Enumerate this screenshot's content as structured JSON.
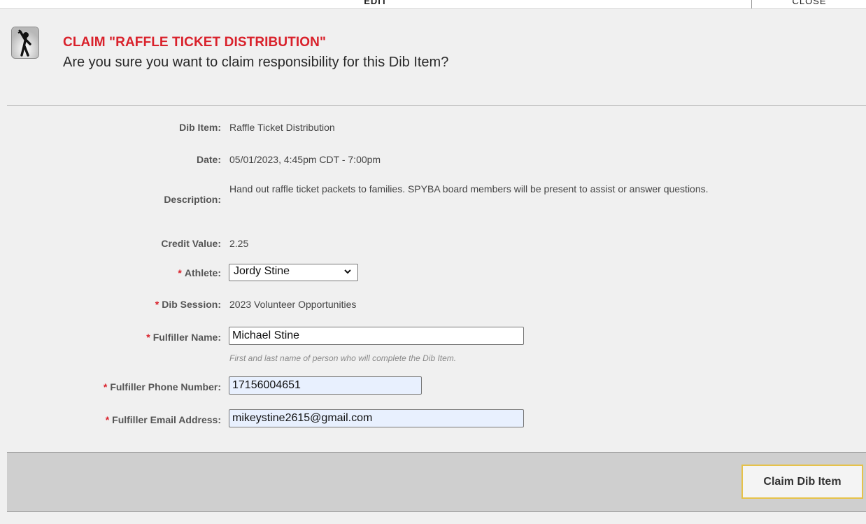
{
  "topbar": {
    "edit_label": "EDIT",
    "close_label": "CLOSE"
  },
  "header": {
    "title": "CLAIM \"RAFFLE TICKET DISTRIBUTION\"",
    "subtitle": "Are you sure you want to claim responsibility for this Dib Item?",
    "icon": "person-waving-icon"
  },
  "form": {
    "dib_item": {
      "label": "Dib Item:",
      "value": "Raffle Ticket Distribution"
    },
    "date": {
      "label": "Date:",
      "value": "05/01/2023, 4:45pm CDT - 7:00pm"
    },
    "description": {
      "label": "Description:",
      "value": "Hand out raffle ticket packets to families. SPYBA board members will be present to assist or answer questions."
    },
    "credit_value": {
      "label": "Credit Value:",
      "value": "2.25"
    },
    "athlete": {
      "required": "*",
      "label": "Athlete:",
      "selected": "Jordy Stine"
    },
    "dib_session": {
      "required": "*",
      "label": "Dib Session:",
      "value": "2023 Volunteer Opportunities"
    },
    "fulfiller_name": {
      "required": "*",
      "label": "Fulfiller Name:",
      "value": "Michael Stine",
      "hint": "First and last name of person who will complete the Dib Item."
    },
    "fulfiller_phone": {
      "required": "*",
      "label": "Fulfiller Phone Number:",
      "value": "17156004651"
    },
    "fulfiller_email": {
      "required": "*",
      "label": "Fulfiller Email Address:",
      "value": "mikeystine2615@gmail.com"
    }
  },
  "footer": {
    "claim_label": "Claim Dib Item"
  },
  "colors": {
    "accent_red": "#d9212b",
    "button_border": "#e6c24a",
    "autofill_bg": "#e8f0fe"
  }
}
